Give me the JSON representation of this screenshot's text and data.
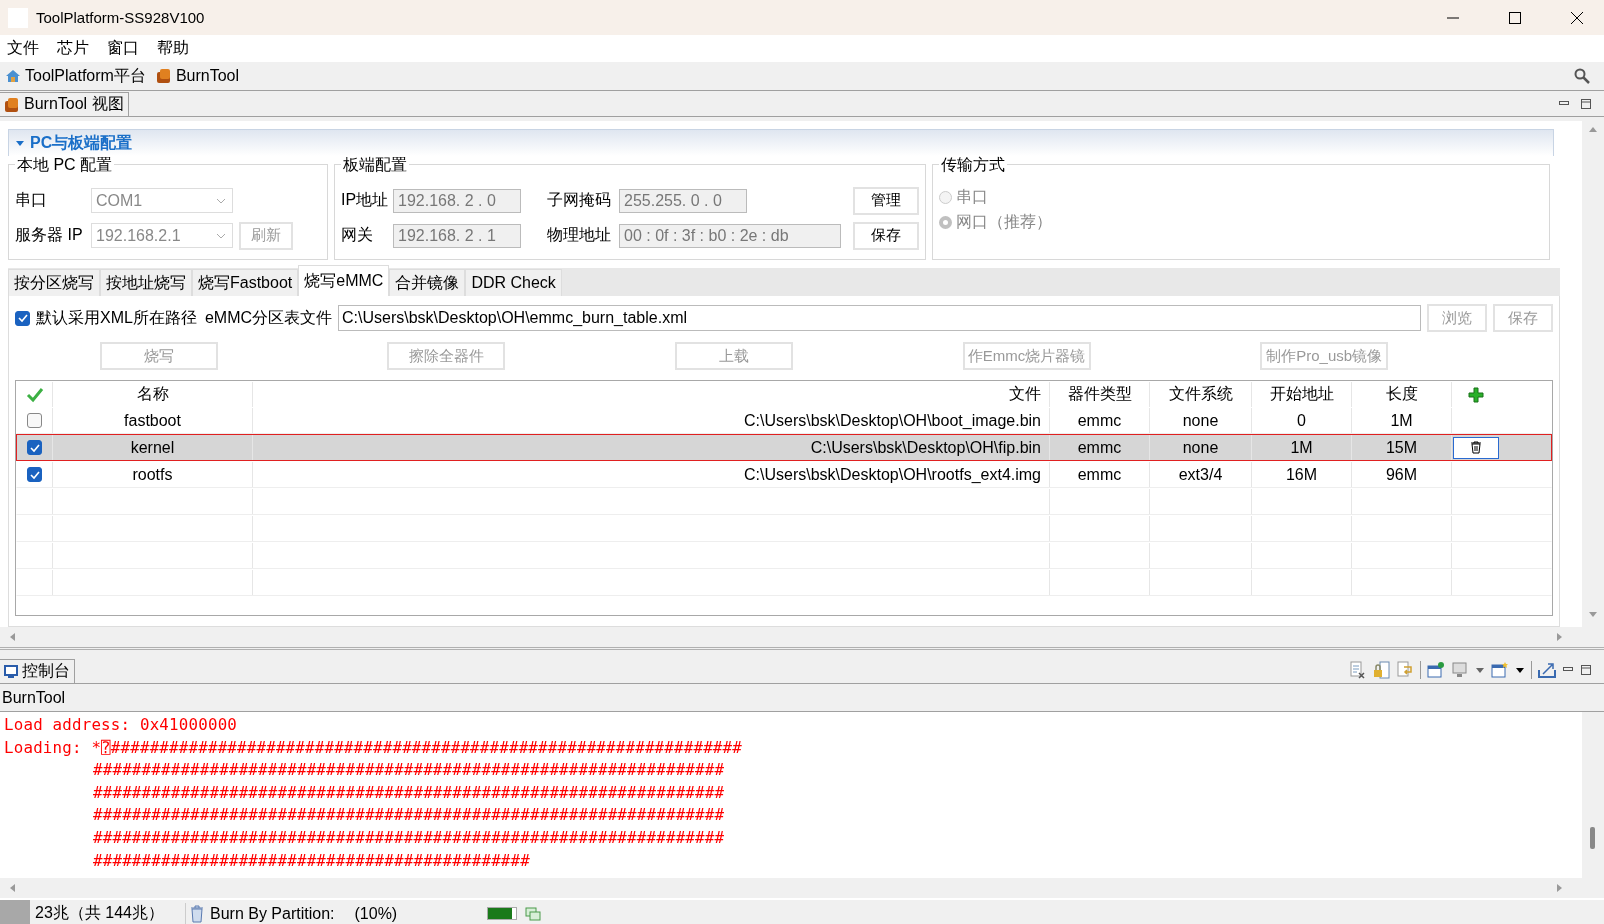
{
  "window": {
    "title": "ToolPlatform-SS928V100"
  },
  "menu": [
    "文件",
    "芯片",
    "窗口",
    "帮助"
  ],
  "toolbar": [
    {
      "kind": "home",
      "label": "ToolPlatform平台"
    },
    {
      "kind": "burn",
      "label": "BurnTool"
    }
  ],
  "view_tab": {
    "label": "BurnTool 视图"
  },
  "section": {
    "title": "PC与板端配置",
    "expanded": true
  },
  "pc_config": {
    "title": "本地 PC 配置",
    "port_label": "串口",
    "port_value": "COM1",
    "server_label": "服务器 IP",
    "server_value": "192.168.2.1",
    "refresh": "刷新"
  },
  "board_config": {
    "title": "板端配置",
    "ip_label": "IP地址",
    "ip": "192.168. 2 . 0",
    "gateway_label": "网关",
    "gateway": "192.168. 2 . 1",
    "subnet_label": "子网掩码",
    "subnet": "255.255. 0 . 0",
    "mac_label": "物理地址",
    "mac": "00 : 0f : 3f : b0 : 2e : db",
    "manage": "管理",
    "save": "保存"
  },
  "transfer": {
    "title": "传输方式",
    "options": [
      {
        "label": "串口",
        "selected": false
      },
      {
        "label": "网口（推荐）",
        "selected": true
      }
    ]
  },
  "tabs": [
    {
      "label": "按分区烧写",
      "selected": false
    },
    {
      "label": "按地址烧写",
      "selected": false
    },
    {
      "label": "烧写Fastboot",
      "selected": false
    },
    {
      "label": "烧写eMMC",
      "selected": true
    },
    {
      "label": "合并镜像",
      "selected": false
    },
    {
      "label": "DDR Check",
      "selected": false
    }
  ],
  "emmc": {
    "default_path_checked": true,
    "default_path_label": "默认采用XML所在路径",
    "file_label": "eMMC分区表文件",
    "file_value": "C:\\Users\\bsk\\Desktop\\OH\\emmc_burn_table.xml",
    "browse": "浏览",
    "save": "保存",
    "actions": [
      {
        "label": "烧写",
        "disabled": true
      },
      {
        "label": "擦除全器件",
        "disabled": true
      },
      {
        "label": "上载",
        "disabled": true
      },
      {
        "label": "作Emmc烧片器镜",
        "disabled": true
      },
      {
        "label": "制作Pro_usb镜像",
        "disabled": true
      }
    ]
  },
  "table": {
    "columns": [
      "名称",
      "文件",
      "器件类型",
      "文件系统",
      "开始地址",
      "长度"
    ],
    "rows": [
      {
        "checked": false,
        "selected": false,
        "name": "fastboot",
        "file": "C:\\Users\\bsk\\Desktop\\OH\\boot_image.bin",
        "type": "emmc",
        "fs": "none",
        "start": "0",
        "length": "1M"
      },
      {
        "checked": true,
        "selected": true,
        "name": "kernel",
        "file": "C:\\Users\\bsk\\Desktop\\OH\\fip.bin",
        "type": "emmc",
        "fs": "none",
        "start": "1M",
        "length": "15M"
      },
      {
        "checked": true,
        "selected": false,
        "name": "rootfs",
        "file": "C:\\Users\\bsk\\Desktop\\OH\\rootfs_ext4.img",
        "type": "emmc",
        "fs": "ext3/4",
        "start": "16M",
        "length": "96M"
      }
    ]
  },
  "console": {
    "tab": "控制台",
    "label": "BurnTool",
    "lines": [
      {
        "kind": "plain",
        "text": "Load address: 0x41000000"
      },
      {
        "kind": "plain",
        "text": "Loading: *⍰#################################################################"
      },
      {
        "kind": "continued",
        "text": "#################################################################"
      },
      {
        "kind": "continued",
        "text": "#################################################################"
      },
      {
        "kind": "continued",
        "text": "#################################################################"
      },
      {
        "kind": "continued",
        "text": "#################################################################"
      },
      {
        "kind": "continued",
        "text": "#############################################"
      }
    ]
  },
  "status_bar": {
    "memory": "23兆（共 144兆）",
    "task": "Burn By Partition:",
    "percent": "(10%)",
    "level": 0.85
  }
}
